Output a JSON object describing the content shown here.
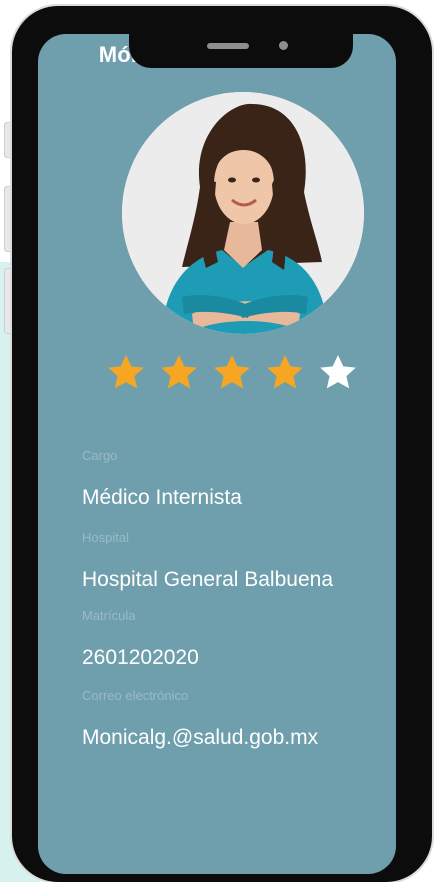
{
  "screen": {
    "title": "Mónica Latorre García"
  },
  "profile": {
    "photo_alt": "doctor-photo",
    "rating": {
      "value": 4,
      "max": 5,
      "filled_color": "#f6a623",
      "empty_color": "#ffffff"
    }
  },
  "fields": [
    {
      "label": "Cargo",
      "value": "Médico Internista"
    },
    {
      "label": "Hospital",
      "value": "Hospital General Balbuena"
    },
    {
      "label": "Matrícula",
      "value": "2601202020"
    },
    {
      "label": "Correo electrónico",
      "value": "Monicalg.@salud.gob.mx"
    }
  ],
  "colors": {
    "screen_bg": "#6f9fad",
    "label": "#98bbc5",
    "value": "#ffffff",
    "frame": "#0c0c0c"
  }
}
